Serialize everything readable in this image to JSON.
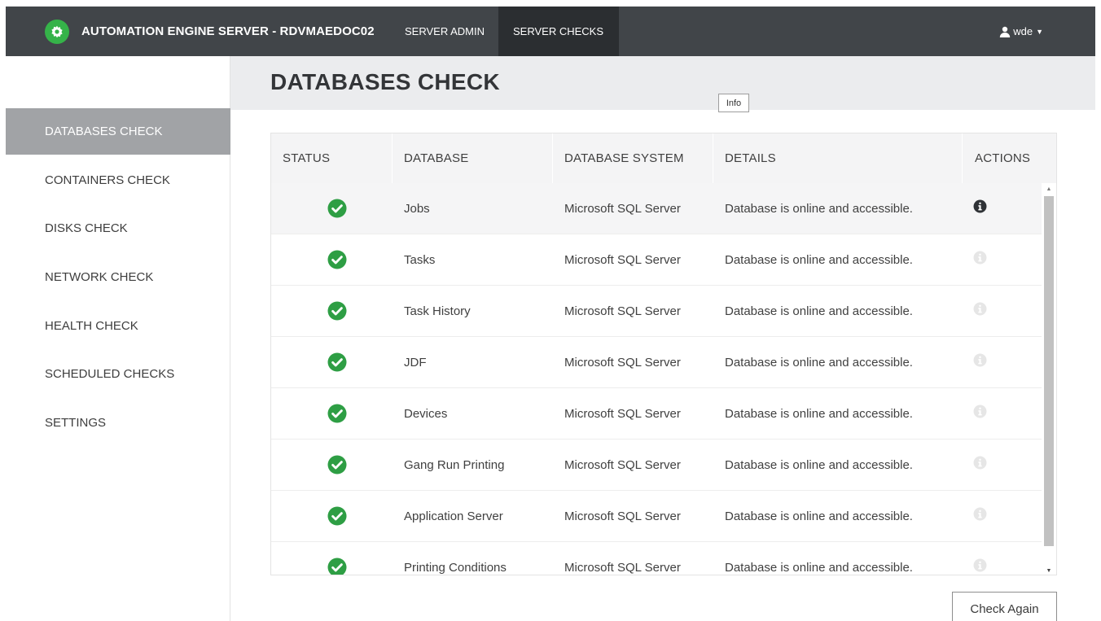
{
  "app": {
    "title": "AUTOMATION ENGINE SERVER - RDVMAEDOC02"
  },
  "nav": {
    "tabs": [
      {
        "label": "SERVER ADMIN",
        "active": false
      },
      {
        "label": "SERVER CHECKS",
        "active": true
      }
    ],
    "user": "wde",
    "user_icon": "user-icon"
  },
  "page": {
    "title": "DATABASES CHECK"
  },
  "sidebar": {
    "items": [
      {
        "label": "DATABASES CHECK",
        "active": true
      },
      {
        "label": "CONTAINERS CHECK",
        "active": false
      },
      {
        "label": "DISKS CHECK",
        "active": false
      },
      {
        "label": "NETWORK CHECK",
        "active": false
      },
      {
        "label": "HEALTH CHECK",
        "active": false
      },
      {
        "label": "SCHEDULED CHECKS",
        "active": false
      },
      {
        "label": "SETTINGS",
        "active": false
      }
    ]
  },
  "table": {
    "headers": [
      "STATUS",
      "DATABASE",
      "DATABASE SYSTEM",
      "DETAILS",
      "ACTIONS"
    ],
    "rows": [
      {
        "status": "ok",
        "database": "Jobs",
        "system": "Microsoft SQL Server",
        "details": "Database is online and accessible."
      },
      {
        "status": "ok",
        "database": "Tasks",
        "system": "Microsoft SQL Server",
        "details": "Database is online and accessible."
      },
      {
        "status": "ok",
        "database": "Task History",
        "system": "Microsoft SQL Server",
        "details": "Database is online and accessible."
      },
      {
        "status": "ok",
        "database": "JDF",
        "system": "Microsoft SQL Server",
        "details": "Database is online and accessible."
      },
      {
        "status": "ok",
        "database": "Devices",
        "system": "Microsoft SQL Server",
        "details": "Database is online and accessible."
      },
      {
        "status": "ok",
        "database": "Gang Run Printing",
        "system": "Microsoft SQL Server",
        "details": "Database is online and accessible."
      },
      {
        "status": "ok",
        "database": "Application Server",
        "system": "Microsoft SQL Server",
        "details": "Database is online and accessible."
      },
      {
        "status": "ok",
        "database": "Printing Conditions",
        "system": "Microsoft SQL Server",
        "details": "Database is online and accessible."
      }
    ],
    "tooltip": "Info"
  },
  "actions": {
    "check_again": "Check Again"
  },
  "colors": {
    "topbar": "#414549",
    "active_tab": "#2b2e31",
    "brand_green": "#35b349",
    "status_green": "#2e9e44",
    "sidebar_active": "#a1a3a6"
  }
}
